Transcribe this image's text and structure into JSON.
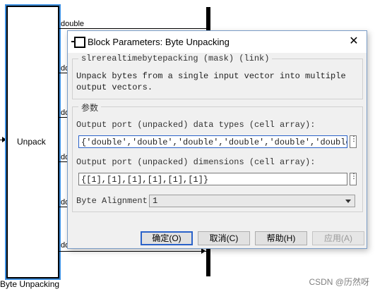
{
  "canvas": {
    "block_label": "Unpack",
    "block_name": "Byte Unpacking",
    "output_labels": [
      "double",
      "do",
      "do",
      "do",
      "do",
      "do"
    ]
  },
  "dialog": {
    "title": "Block Parameters: Byte Unpacking",
    "close_label": "✕",
    "mask_title": "slrerealtimebytepacking (mask) (link)",
    "description": "Unpack bytes from a single input vector into multiple output vectors.",
    "params_title": "参数",
    "data_types_label": "Output port (unpacked) data types (cell array):",
    "data_types_value": "{'double','double','double','double','double','double'}",
    "dimensions_label": "Output port (unpacked) dimensions (cell array):",
    "dimensions_value": "{[1],[1],[1],[1],[1],[1]}",
    "alignment_label": "Byte Alignment:",
    "alignment_value": "1",
    "more_icon": "⋮",
    "buttons": {
      "ok": "确定(O)",
      "cancel": "取消(C)",
      "help": "帮助(H)",
      "apply": "应用(A)"
    }
  },
  "watermark": "CSDN @历然呀"
}
